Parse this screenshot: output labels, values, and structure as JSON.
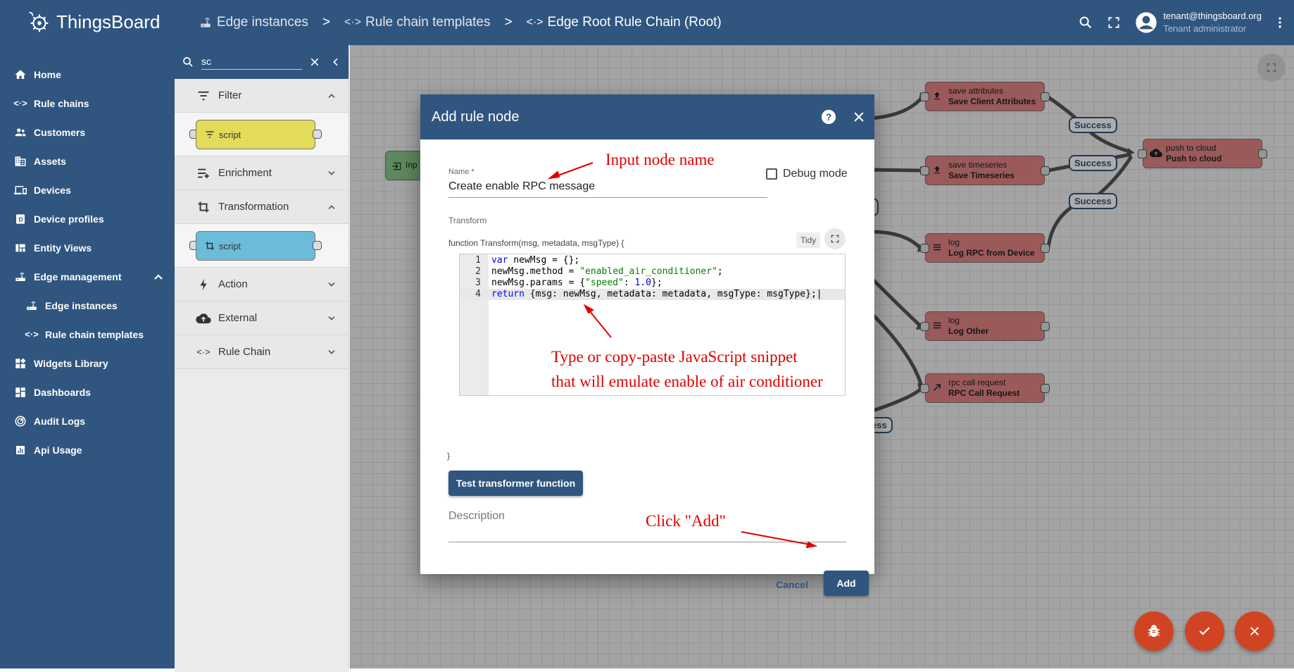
{
  "app": {
    "name": "ThingsBoard"
  },
  "breadcrumbs": [
    {
      "label": "Edge instances"
    },
    {
      "label": "Rule chain templates"
    },
    {
      "label": "Edge Root Rule Chain (Root)"
    }
  ],
  "breadcrumb_separator": ">",
  "user": {
    "email": "tenant@thingsboard.org",
    "role": "Tenant administrator"
  },
  "sidebar": {
    "items": [
      {
        "label": "Home",
        "icon": "home-icon"
      },
      {
        "label": "Rule chains",
        "icon": "rule-chain-icon"
      },
      {
        "label": "Customers",
        "icon": "people-icon"
      },
      {
        "label": "Assets",
        "icon": "domain-icon"
      },
      {
        "label": "Devices",
        "icon": "devices-icon"
      },
      {
        "label": "Device profiles",
        "icon": "device-profile-icon"
      },
      {
        "label": "Entity Views",
        "icon": "view-quilt-icon"
      },
      {
        "label": "Edge management",
        "icon": "router-icon"
      },
      {
        "label": "Edge instances",
        "icon": "router-icon"
      },
      {
        "label": "Rule chain templates",
        "icon": "rule-chain-icon"
      },
      {
        "label": "Widgets Library",
        "icon": "widgets-icon"
      },
      {
        "label": "Dashboards",
        "icon": "dashboard-icon"
      },
      {
        "label": "Audit Logs",
        "icon": "track-changes-icon"
      },
      {
        "label": "Api Usage",
        "icon": "insert-chart-icon"
      }
    ]
  },
  "library": {
    "search_value": "sc",
    "categories": [
      {
        "label": "Filter",
        "expanded": true,
        "node": "script",
        "color": "#e2dc5a"
      },
      {
        "label": "Enrichment",
        "expanded": false
      },
      {
        "label": "Transformation",
        "expanded": true,
        "node": "script",
        "color": "#6bbcd8"
      },
      {
        "label": "Action",
        "expanded": false
      },
      {
        "label": "External",
        "expanded": false
      },
      {
        "label": "Rule Chain",
        "expanded": false
      }
    ]
  },
  "canvas": {
    "input_node": "Inp",
    "nodes": [
      {
        "type": "save attributes",
        "name": "Save Client Attributes"
      },
      {
        "type": "save timeseries",
        "name": "Save Timeseries"
      },
      {
        "type": "log",
        "name": "Log RPC from Device"
      },
      {
        "type": "log",
        "name": "Log Other"
      },
      {
        "type": "rpc call request",
        "name": "RPC Call Request"
      },
      {
        "type": "push to cloud",
        "name": "Push to cloud"
      }
    ],
    "edge_labels": [
      "Success",
      "Success",
      "Success",
      "ess"
    ]
  },
  "dialog": {
    "title": "Add rule node",
    "name_label": "Name *",
    "name_value": "Create enable RPC message",
    "debug_label": "Debug mode",
    "transform_label": "Transform",
    "function_header": "function Transform(msg, metadata, msgType) {",
    "function_footer": "}",
    "tidy_label": "Tidy",
    "code_lines": [
      "var newMsg = {};",
      "newMsg.method = \"enabled_air_conditioner\";",
      "newMsg.params = {\"speed\": 1.0};",
      "return {msg: newMsg, metadata: metadata, msgType: msgType};"
    ],
    "test_button": "Test transformer function",
    "description_label": "Description",
    "cancel_label": "Cancel",
    "add_label": "Add"
  },
  "annotations": {
    "input_name": "Input node name",
    "snippet_line1": "Type or copy-paste JavaScript snippet",
    "snippet_line2": "that will emulate enable of air conditioner",
    "click_add": "Click \"Add\""
  },
  "colors": {
    "primary": "#305680",
    "accent": "#d14423",
    "annotation": "#e00000",
    "node_action": "#e38585",
    "node_input": "#8bc98b"
  }
}
